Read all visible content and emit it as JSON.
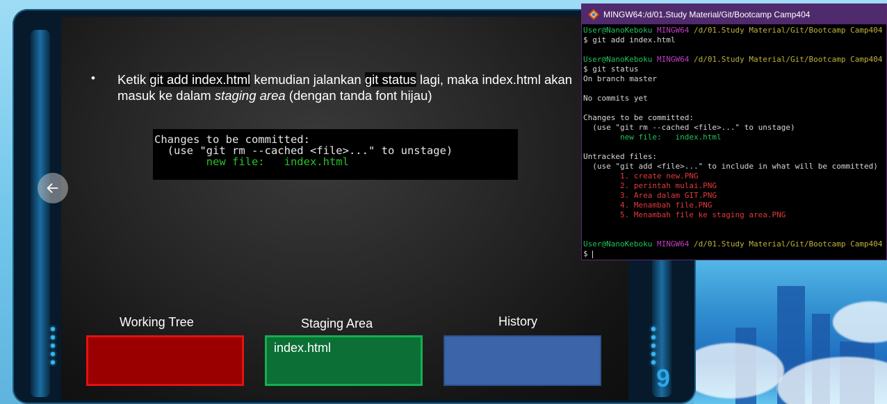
{
  "slide": {
    "bullet_marker": "•",
    "bullet_part1": "Ketik ",
    "bullet_cmd1": "git add index.html",
    "bullet_part2": " kemudian jalankan ",
    "bullet_cmd2": "git status",
    "bullet_part3": " lagi, maka index.html akan masuk ke dalam ",
    "bullet_italic": "staging area",
    "bullet_part4": " (dengan tanda font hijau)",
    "code": {
      "line1": "Changes to be committed:",
      "line2": "  (use \"git rm --cached <file>...\" to unstage)",
      "line3_indent": "        ",
      "line3_green": "new file:   index.html"
    },
    "stages": {
      "working_tree_label": "Working Tree",
      "staging_area_label": "Staging Area",
      "history_label": "History",
      "staging_item": "index.html"
    },
    "page_number": "9"
  },
  "terminal": {
    "title": "MINGW64:/d/01.Study Material/Git/Bootcamp Camp404",
    "user": "User@NanoKeboku",
    "shell": "MINGW64",
    "path": "/d/01.Study Material/Git/Bootcamp Camp404",
    "cmd1": "$ git add index.html",
    "cmd2": "$ git status",
    "branch": "On branch master",
    "no_commits": "No commits yet",
    "changes_header": "Changes to be committed:",
    "changes_hint": "  (use \"git rm --cached <file>...\" to unstage)",
    "new_file": "        new file:   index.html",
    "untracked_header": "Untracked files:",
    "untracked_hint": "  (use \"git add <file>...\" to include in what will be committed)",
    "untracked_files": [
      "        1. create new.PNG",
      "        2. perintah mulai.PNG",
      "        3. Area dalam GIT.PNG",
      "        4. Menambah file.PNG",
      "        5. Menambah file ke staging area.PNG"
    ],
    "prompt": "$ "
  },
  "colors": {
    "working_tree": "#9a0000",
    "staging_area": "#0b6f36",
    "history": "#3c64a8",
    "terminal_title_bg": "#4f2a6c",
    "git_green": "#20c35b",
    "git_red": "#e23a3a"
  },
  "icons": {
    "back": "arrow-left-icon",
    "terminal": "git-bash-icon"
  }
}
